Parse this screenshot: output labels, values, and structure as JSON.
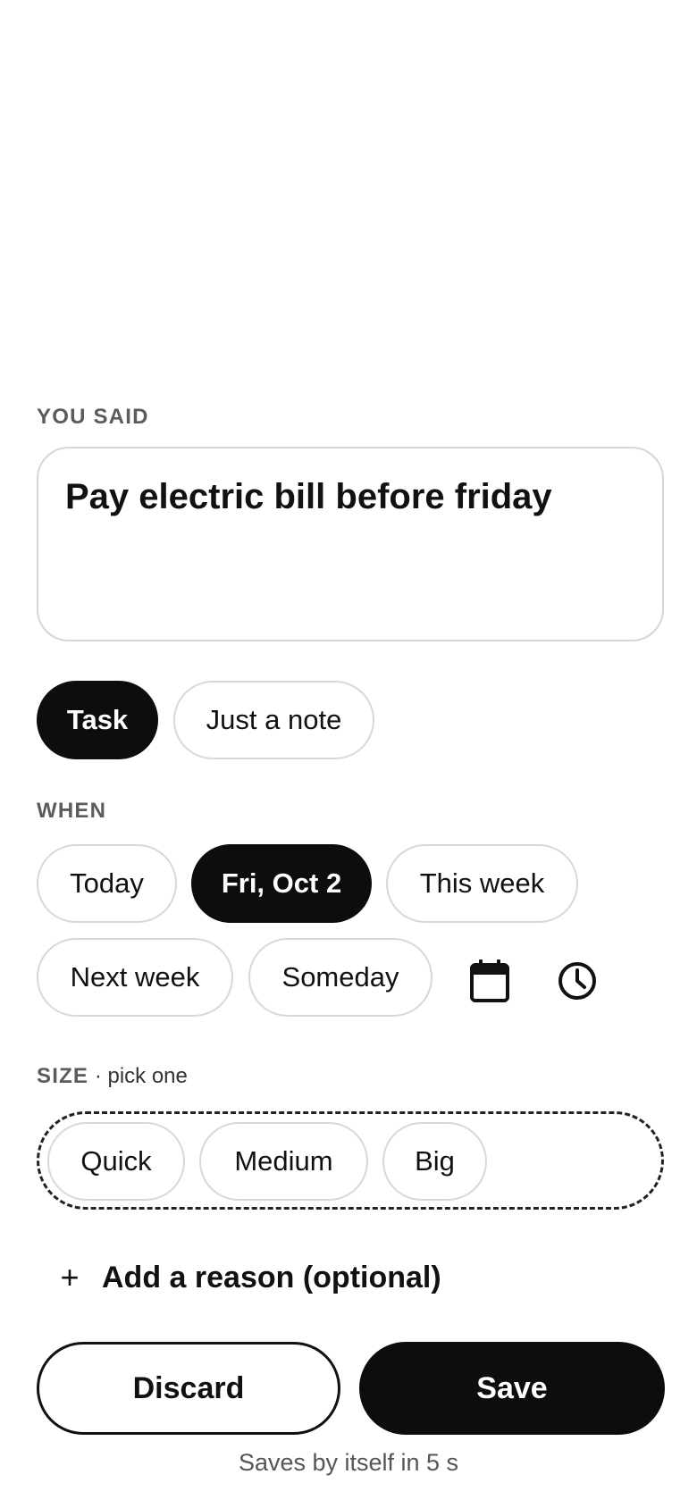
{
  "you_said": {
    "label": "YOU SAID",
    "text": "Pay electric bill before friday"
  },
  "kind": {
    "options": [
      "Task",
      "Just a note"
    ],
    "selected": "Task"
  },
  "when": {
    "label": "WHEN",
    "options": [
      "Today",
      "Fri, Oct 2",
      "This week",
      "Next week",
      "Someday"
    ],
    "selected": "Fri, Oct 2",
    "icons": [
      "calendar-icon",
      "clock-icon"
    ]
  },
  "size": {
    "label": "SIZE",
    "sub_label": " · pick one",
    "options": [
      "Quick",
      "Medium",
      "Big"
    ]
  },
  "add_reason": {
    "plus": "+",
    "label": "Add a reason (optional)"
  },
  "actions": {
    "discard": "Discard",
    "save": "Save"
  },
  "footer": {
    "autosave": "Saves by itself in 5 s"
  }
}
